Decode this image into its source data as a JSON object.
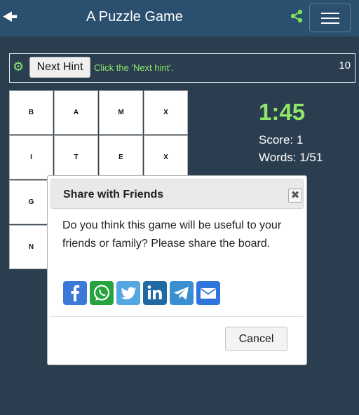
{
  "header": {
    "title": "A Puzzle Game",
    "back_icon": "arrow-left-icon",
    "share_icon": "share-icon",
    "menu_icon": "hamburger-menu-icon",
    "background": "#2b4f6e"
  },
  "hint": {
    "button_label": "Next Hint",
    "message": "Click the 'Next hint'.",
    "count": "10",
    "icon": "gear-icon",
    "accent": "#8de86a"
  },
  "board": {
    "rows": [
      [
        "B",
        "A",
        "M",
        "X"
      ],
      [
        "I",
        "T",
        "E",
        "X"
      ],
      [
        "G",
        "",
        "",
        ""
      ],
      [
        "N",
        "",
        "",
        ""
      ]
    ]
  },
  "stats": {
    "time": "1:45",
    "score": "Score: 1",
    "words": "Words: 1/51"
  },
  "modal": {
    "title": "Share with Friends",
    "message": "Do you think this game will be useful to your friends or family? Please share the board.",
    "cancel_label": "Cancel",
    "close_icon": "close-icon",
    "share_options": [
      {
        "name": "facebook",
        "icon": "facebook-icon",
        "color": "#3b78d8"
      },
      {
        "name": "whatsapp",
        "icon": "whatsapp-icon",
        "color": "#26a33f"
      },
      {
        "name": "twitter",
        "icon": "twitter-icon",
        "color": "#55a7e2"
      },
      {
        "name": "linkedin",
        "icon": "linkedin-icon",
        "color": "#1f6aa3"
      },
      {
        "name": "telegram",
        "icon": "telegram-icon",
        "color": "#3a8fd0"
      },
      {
        "name": "email",
        "icon": "email-icon",
        "color": "#2f74dc"
      }
    ]
  }
}
